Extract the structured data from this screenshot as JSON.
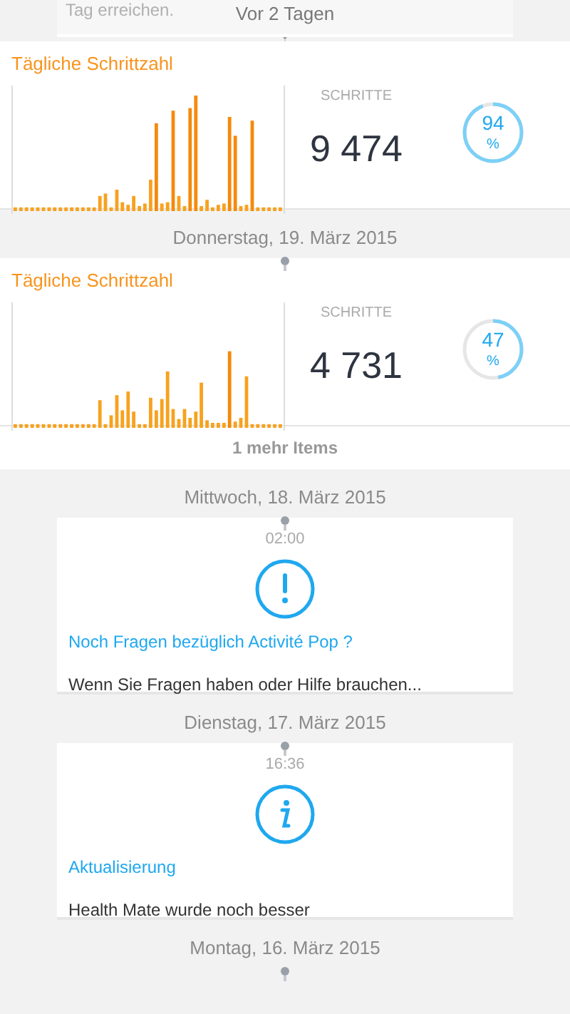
{
  "feed": [
    {
      "kind": "partial",
      "text": "Tag erreichen.",
      "date": "Vor 2 Tagen"
    },
    {
      "kind": "steps",
      "title": "Tägliche Schrittzahl",
      "label": "SCHRITTE",
      "value": "9 474",
      "percent": "94",
      "unit": "%",
      "level": 0.94
    },
    {
      "kind": "date",
      "date": "Donnerstag, 19. März 2015"
    },
    {
      "kind": "steps",
      "title": "Tägliche Schrittzahl",
      "label": "SCHRITTE",
      "value": "4 731",
      "percent": "47",
      "unit": "%",
      "level": 0.47
    },
    {
      "kind": "more",
      "text": "1 mehr Items"
    },
    {
      "kind": "date",
      "date": "Mittwoch, 18. März 2015"
    },
    {
      "kind": "alert",
      "time": "02:00",
      "title": "Noch Fragen bezüglich Activité Pop ?",
      "body": "Wenn Sie Fragen haben oder Hilfe brauchen..."
    },
    {
      "kind": "date",
      "date": "Dienstag, 17. März 2015"
    },
    {
      "kind": "info",
      "time": "16:36",
      "title": "Aktualisierung",
      "body": "Health Mate wurde noch besser"
    },
    {
      "kind": "date",
      "date": "Montag, 16. März 2015"
    }
  ]
}
